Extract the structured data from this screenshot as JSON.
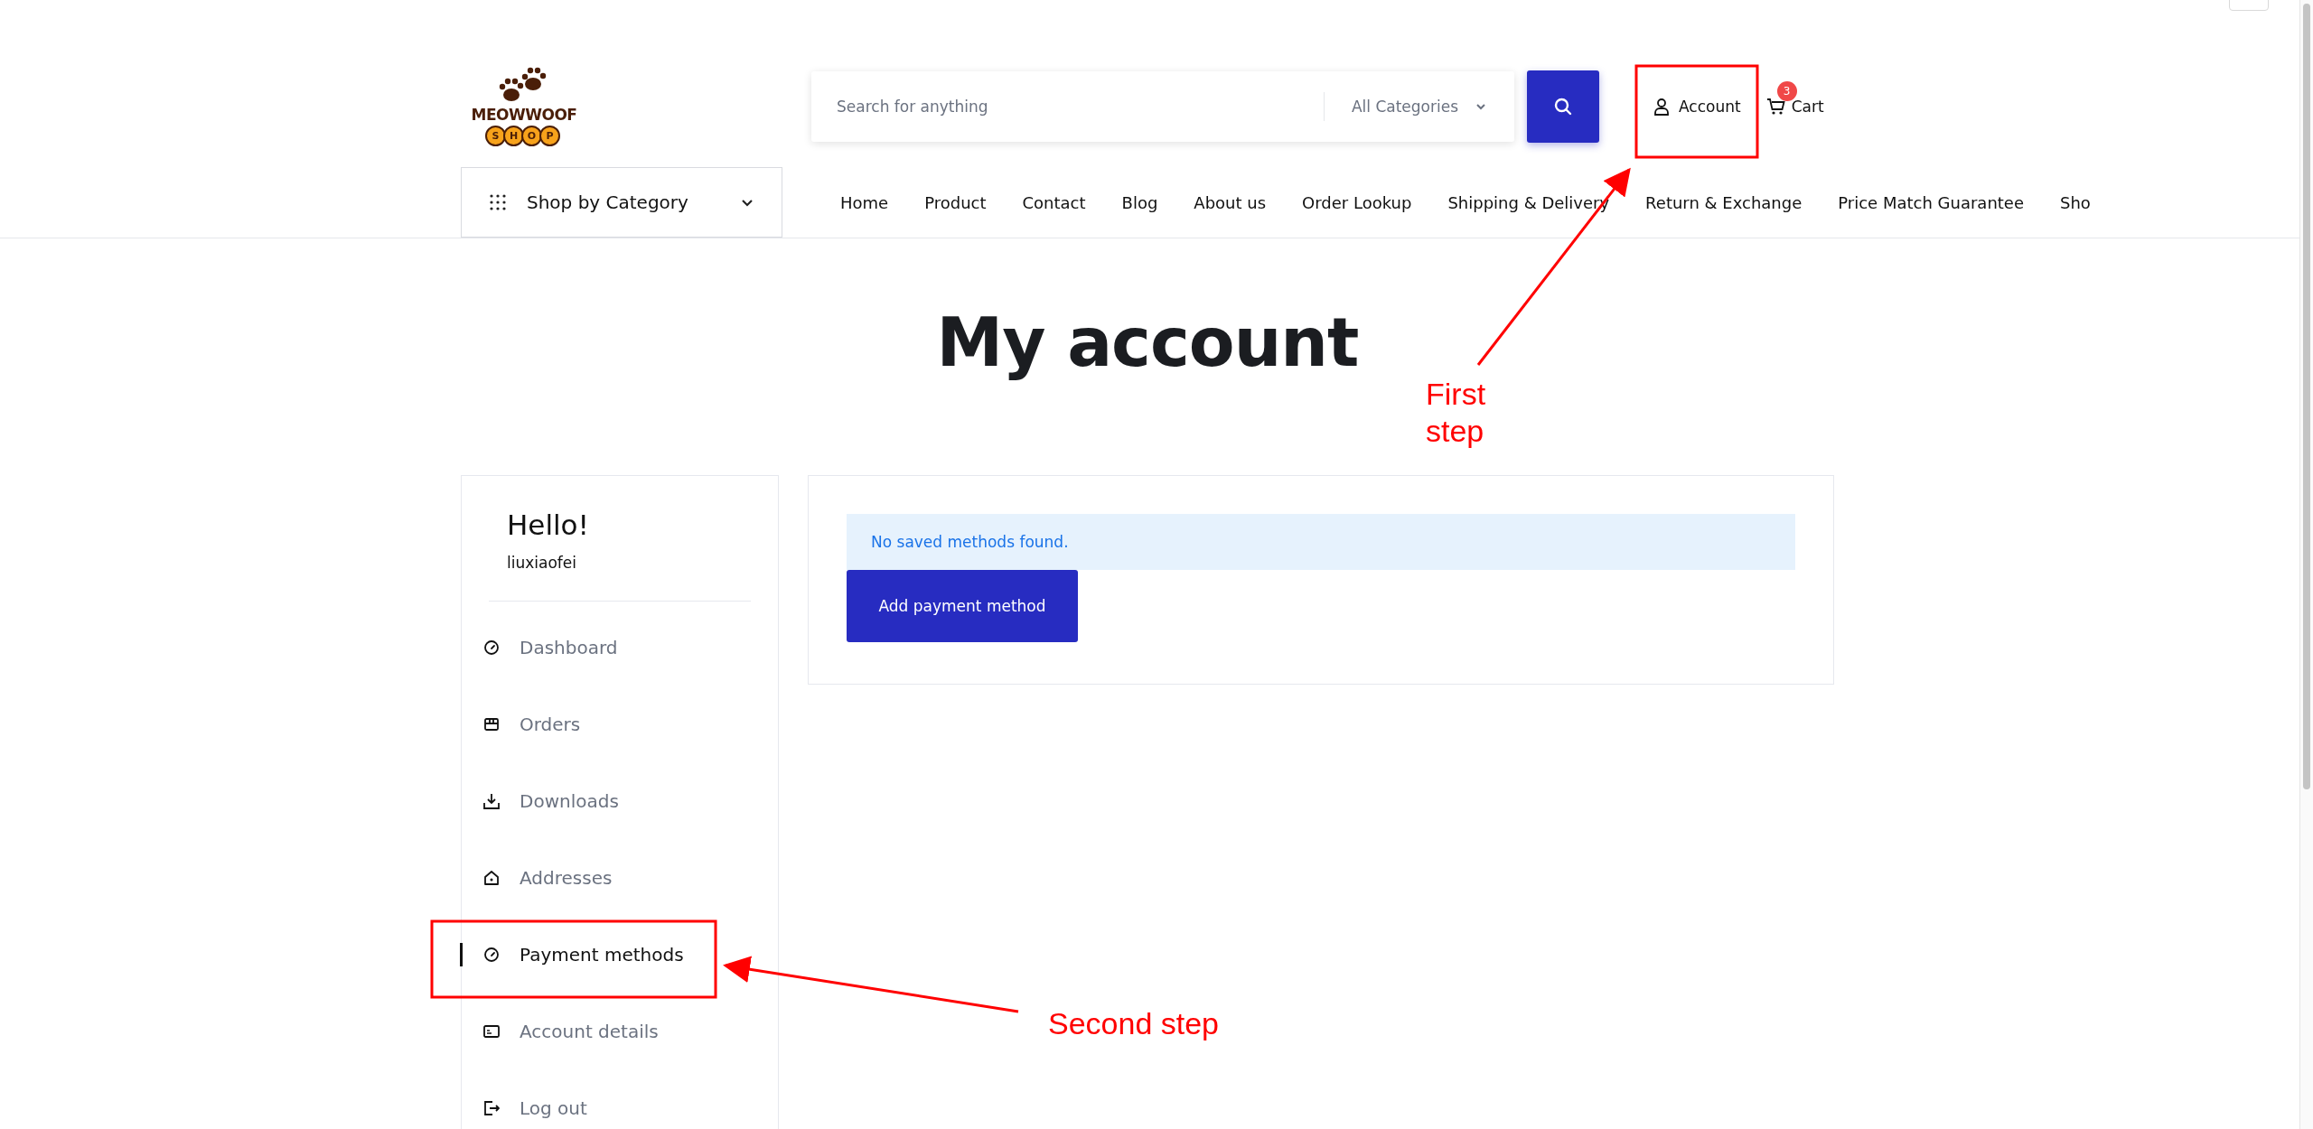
{
  "logo": {
    "name": "MEOWWOOF",
    "badge": [
      "S",
      "H",
      "O",
      "P"
    ]
  },
  "search": {
    "placeholder": "Search for anything",
    "category": "All Categories"
  },
  "account_link": "Account",
  "cart": {
    "label": "Cart",
    "count": "3"
  },
  "category_menu": "Shop by Category",
  "nav": [
    "Home",
    "Product",
    "Contact",
    "Blog",
    "About us",
    "Order Lookup",
    "Shipping & Delivery",
    "Return & Exchange",
    "Price Match Guarantee",
    "Sho"
  ],
  "page_title": "My account",
  "sidebar": {
    "greeting": "Hello!",
    "username": "liuxiaofei",
    "items": [
      {
        "label": "Dashboard",
        "kind": "gauge",
        "selected": false
      },
      {
        "label": "Orders",
        "kind": "box",
        "selected": false
      },
      {
        "label": "Downloads",
        "kind": "download",
        "selected": false
      },
      {
        "label": "Addresses",
        "kind": "house",
        "selected": false
      },
      {
        "label": "Payment methods",
        "kind": "gauge",
        "selected": true
      },
      {
        "label": "Account details",
        "kind": "card",
        "selected": false
      },
      {
        "label": "Log out",
        "kind": "logout",
        "selected": false
      }
    ]
  },
  "notice": "No saved methods found.",
  "add_button": "Add payment method",
  "annotations": [
    {
      "text": "First step"
    },
    {
      "text": "Second step"
    }
  ]
}
